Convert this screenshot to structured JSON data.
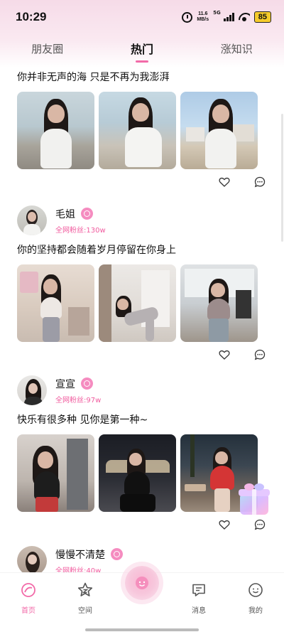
{
  "status_bar": {
    "time": "10:29",
    "net_speed_value": "11.6",
    "net_speed_unit": "MB/s",
    "signal_label": "5G",
    "battery": "85"
  },
  "tabs": [
    {
      "label": "朋友圈",
      "active": false
    },
    {
      "label": "热门",
      "active": true
    },
    {
      "label": "涨知识",
      "active": false
    }
  ],
  "posts": [
    {
      "text": "你并非无声的海 只是不再为我澎湃"
    },
    {
      "user": {
        "name": "毛姐",
        "fans": "全网粉丝:130w"
      },
      "text": "你的坚持都会随着岁月停留在你身上"
    },
    {
      "user": {
        "name": "宣宣",
        "fans": "全网粉丝:97w"
      },
      "text": "快乐有很多种 见你是第一种~"
    },
    {
      "user": {
        "name": "慢慢不清楚",
        "fans": "全网粉丝:40w"
      }
    }
  ],
  "bottom_nav": [
    {
      "label": "首页",
      "icon": "home-icon",
      "active": true
    },
    {
      "label": "空间",
      "icon": "space-icon",
      "active": false
    },
    {
      "label": "消息",
      "icon": "message-icon",
      "active": false
    },
    {
      "label": "我的",
      "icon": "profile-icon",
      "active": false
    }
  ],
  "colors": {
    "accent": "#f26aa8",
    "fans_text": "#f15c9f"
  }
}
